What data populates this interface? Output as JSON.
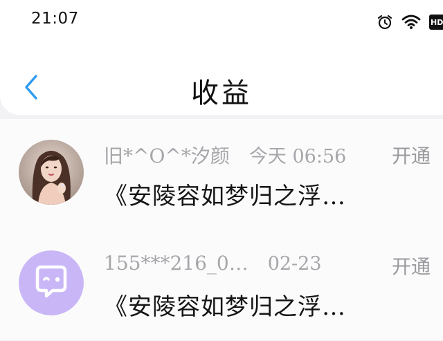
{
  "status_bar": {
    "time": "21:07",
    "icons": [
      "alarm-icon",
      "wifi-icon",
      "hd-icon"
    ],
    "hd_label": "HD"
  },
  "header": {
    "back_icon": "chevron-left-icon",
    "title": "收益",
    "accent_color": "#2f9bf0"
  },
  "earnings": [
    {
      "avatar": "user-photo",
      "username": "旧*^O^*汐颜",
      "date": "今天 06:56",
      "action": "开通",
      "book_title": "《安陵容如梦归之浮…"
    },
    {
      "avatar": "default-chat-icon",
      "avatar_color": "#c9b6f7",
      "username": "155***216_0…",
      "date": "02-23",
      "action": "开通",
      "book_title": "《安陵容如梦归之浮…"
    }
  ]
}
